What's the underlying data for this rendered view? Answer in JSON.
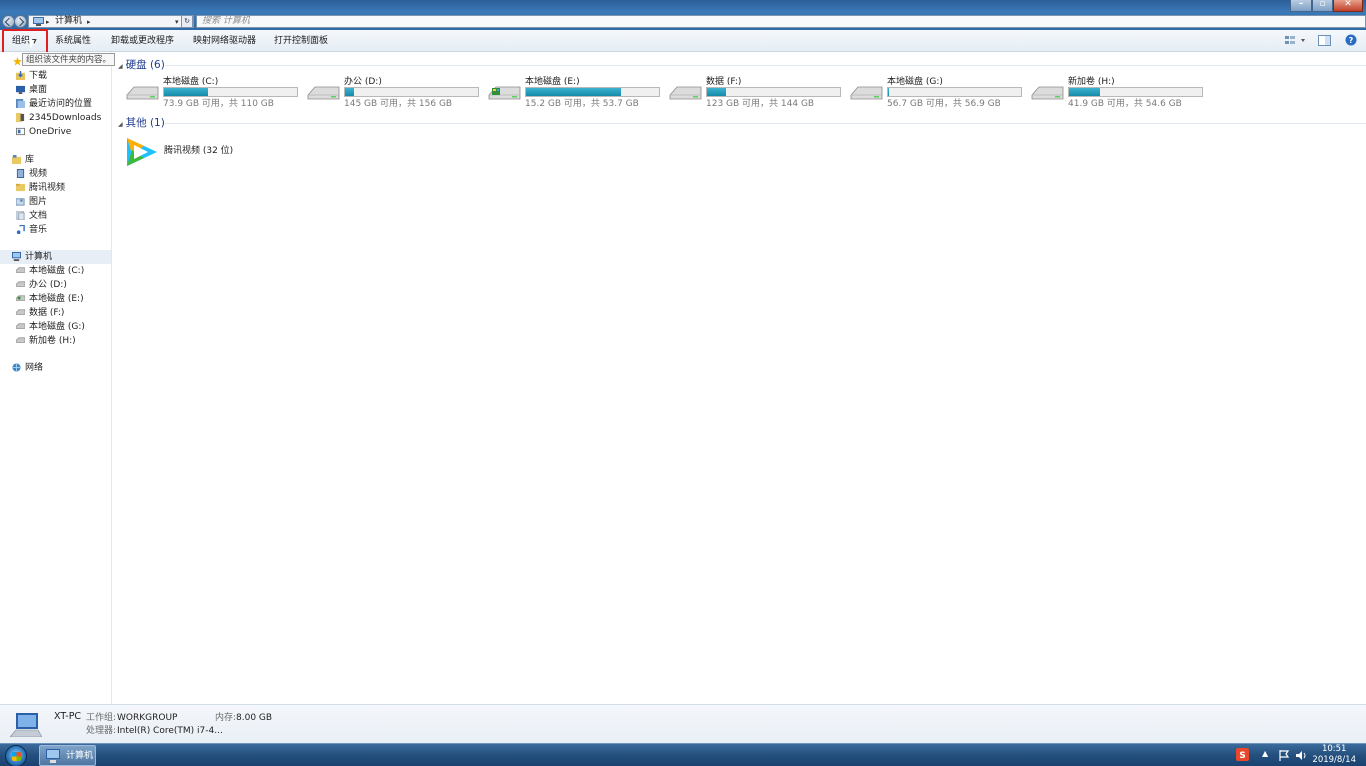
{
  "window": {
    "address_crumb": "计算机",
    "search_placeholder": "搜索 计算机"
  },
  "toolbar": {
    "organize": "组织",
    "system_properties": "系统属性",
    "uninstall": "卸载或更改程序",
    "map_drive": "映射网络驱动器",
    "control_panel": "打开控制面板"
  },
  "tooltip": "组织该文件夹的内容。",
  "sidebar": {
    "favorites": [
      "下载",
      "桌面",
      "最近访问的位置",
      "2345Downloads",
      "OneDrive"
    ],
    "library_title": "库",
    "library": [
      "视频",
      "腾讯视频",
      "图片",
      "文档",
      "音乐"
    ],
    "computer_title": "计算机",
    "drives": [
      "本地磁盘 (C:)",
      "办公 (D:)",
      "本地磁盘 (E:)",
      "数据 (F:)",
      "本地磁盘 (G:)",
      "新加卷 (H:)"
    ],
    "network_title": "网络"
  },
  "groups": {
    "hdd_title": "硬盘 (6)",
    "other_title": "其他 (1)"
  },
  "drives": [
    {
      "name": "本地磁盘 (C:)",
      "info": "73.9 GB 可用，共 110 GB",
      "used_fraction": 0.328
    },
    {
      "name": "办公 (D:)",
      "info": "145 GB 可用，共 156 GB",
      "used_fraction": 0.071
    },
    {
      "name": "本地磁盘 (E:)",
      "info": "15.2 GB 可用，共 53.7 GB",
      "used_fraction": 0.717
    },
    {
      "name": "数据 (F:)",
      "info": "123 GB 可用，共 144 GB",
      "used_fraction": 0.146
    },
    {
      "name": "本地磁盘 (G:)",
      "info": "56.7 GB 可用，共 56.9 GB",
      "used_fraction": 0.004
    },
    {
      "name": "新加卷 (H:)",
      "info": "41.9 GB 可用，共 54.6 GB",
      "used_fraction": 0.233
    }
  ],
  "other_items": [
    {
      "name": "腾讯视频 (32 位)"
    }
  ],
  "details": {
    "pc_name": "XT-PC",
    "workgroup_label": "工作组:",
    "workgroup_value": "WORKGROUP",
    "memory_label": "内存:",
    "memory_value": "8.00 GB",
    "cpu_label": "处理器:",
    "cpu_value": "Intel(R) Core(TM) i7-4..."
  },
  "taskbar": {
    "active_window": "计算机",
    "time": "10:51",
    "date": "2019/8/14"
  },
  "colors": {
    "accent": "#1e3b8f",
    "bar_fill": "#168aaa",
    "highlight": "#e02020",
    "taskbar": "#24507e"
  }
}
